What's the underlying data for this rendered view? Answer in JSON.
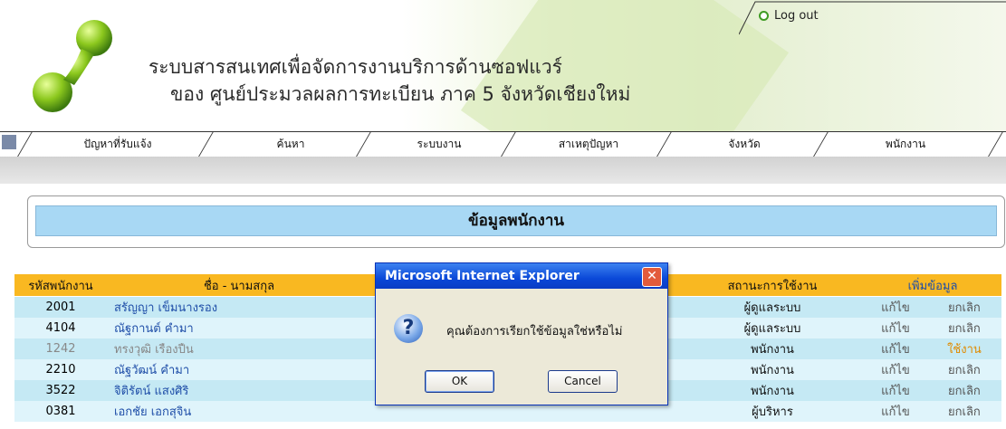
{
  "header": {
    "title_line1": "ระบบสารสนเทศเพื่อจัดการงานบริการด้านซอฟแวร์",
    "title_line2": "ของ ศูนย์ประมวลผลการทะเบียน ภาค 5 จังหวัดเชียงใหม่",
    "logout_label": "Log out"
  },
  "nav": {
    "items": [
      "ปัญหาที่รับแจ้ง",
      "ค้นหา",
      "ระบบงาน",
      "สาเหตุปัญหา",
      "จังหวัด",
      "พนักงาน"
    ]
  },
  "panel": {
    "title": "ข้อมูลพนักงาน"
  },
  "table": {
    "headers": {
      "code": "รหัสพนักงาน",
      "name": "ชื่อ - นามสกุล",
      "status": "สถานะการใช้งาน",
      "add": "เพิ่มข้อมูล"
    },
    "rows": [
      {
        "code": "2001",
        "name": "สรัญญา เข็มนางรอง",
        "status": "ผู้ดูแลระบบ",
        "edit": "แก้ไข",
        "action": "ยกเลิก"
      },
      {
        "code": "4104",
        "name": "ณัฐกานต์ คำมา",
        "status": "ผู้ดูแลระบบ",
        "edit": "แก้ไข",
        "action": "ยกเลิก"
      },
      {
        "code": "1242",
        "name": "ทรงวุฒิ เรืองปืน",
        "status": "พนักงาน",
        "edit": "แก้ไข",
        "action": "ใช้งาน"
      },
      {
        "code": "2210",
        "name": "ณัฐวัฒน์ คำมา",
        "status": "พนักงาน",
        "edit": "แก้ไข",
        "action": "ยกเลิก"
      },
      {
        "code": "3522",
        "name": "จิติรัตน์ แสงศิริ",
        "status": "พนักงาน",
        "edit": "แก้ไข",
        "action": "ยกเลิก"
      },
      {
        "code": "0381",
        "name": "เอกชัย เอกสุจิน",
        "status": "ผู้บริหาร",
        "edit": "แก้ไข",
        "action": "ยกเลิก"
      }
    ]
  },
  "dialog": {
    "title": "Microsoft Internet Explorer",
    "message": "คุณต้องการเรียกใช้ข้อมูลใช่หรือไม่",
    "ok": "OK",
    "cancel": "Cancel",
    "close": "✕",
    "icon": "question-icon"
  }
}
